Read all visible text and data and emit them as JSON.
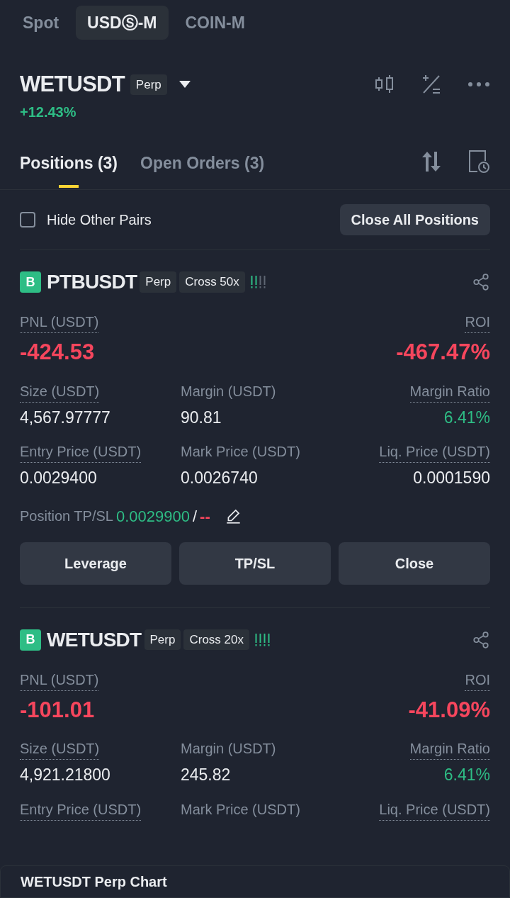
{
  "market_tabs": [
    {
      "label": "Spot",
      "selected": false
    },
    {
      "label": "USDⓈ-M",
      "selected": true
    },
    {
      "label": "COIN-M",
      "selected": false
    }
  ],
  "symbol": {
    "name": "WETUSDT",
    "badge": "Perp",
    "change": "+12.43%"
  },
  "position_tabs": [
    {
      "label": "Positions (3)",
      "selected": true
    },
    {
      "label": "Open Orders (3)",
      "selected": false
    }
  ],
  "hide_other_pairs": {
    "label": "Hide Other Pairs",
    "checked": false
  },
  "close_all_button": "Close All Positions",
  "positions": [
    {
      "side": "B",
      "symbol": "PTBUSDT",
      "badges": [
        "Perp",
        "Cross 50x"
      ],
      "risk_bars": [
        {
          "on": true
        },
        {
          "on": true
        },
        {
          "on": false
        },
        {
          "on": false
        }
      ],
      "pnl": {
        "label": "PNL (USDT)",
        "value": "-424.53"
      },
      "roi": {
        "label": "ROI",
        "value": "-467.47%"
      },
      "fields": [
        {
          "label": "Size (USDT)",
          "dotted": true,
          "value": "4,567.97777",
          "kind": "neutral"
        },
        {
          "label": "Margin (USDT)",
          "dotted": false,
          "value": "90.81",
          "kind": "neutral"
        },
        {
          "label": "Margin Ratio",
          "dotted": true,
          "value": "6.41%",
          "kind": "positive"
        },
        {
          "label": "Entry Price (USDT)",
          "dotted": true,
          "value": "0.0029400",
          "kind": "neutral"
        },
        {
          "label": "Mark Price (USDT)",
          "dotted": false,
          "value": "0.0026740",
          "kind": "neutral"
        },
        {
          "label": "Liq. Price (USDT)",
          "dotted": true,
          "value": "0.0001590",
          "kind": "neutral"
        }
      ],
      "tp_sl": {
        "label": "Position TP/SL",
        "tp": "0.0029900",
        "separator": "/",
        "sl": "--"
      },
      "buttons": [
        "Leverage",
        "TP/SL",
        "Close"
      ]
    },
    {
      "side": "B",
      "symbol": "WETUSDT",
      "badges": [
        "Perp",
        "Cross 20x"
      ],
      "risk_bars": [
        {
          "on": true
        },
        {
          "on": true
        },
        {
          "on": true
        },
        {
          "on": true
        }
      ],
      "pnl": {
        "label": "PNL (USDT)",
        "value": "-101.01"
      },
      "roi": {
        "label": "ROI",
        "value": "-41.09%"
      },
      "fields": [
        {
          "label": "Size (USDT)",
          "dotted": true,
          "value": "4,921.21800",
          "kind": "neutral"
        },
        {
          "label": "Margin (USDT)",
          "dotted": false,
          "value": "245.82",
          "kind": "neutral"
        },
        {
          "label": "Margin Ratio",
          "dotted": true,
          "value": "6.41%",
          "kind": "positive"
        },
        {
          "label": "Entry Price (USDT)",
          "dotted": true
        },
        {
          "label": "Mark Price (USDT)",
          "dotted": false
        },
        {
          "label": "Liq. Price (USDT)",
          "dotted": true
        }
      ]
    }
  ],
  "chart_bar": {
    "title": "WETUSDT Perp Chart"
  }
}
